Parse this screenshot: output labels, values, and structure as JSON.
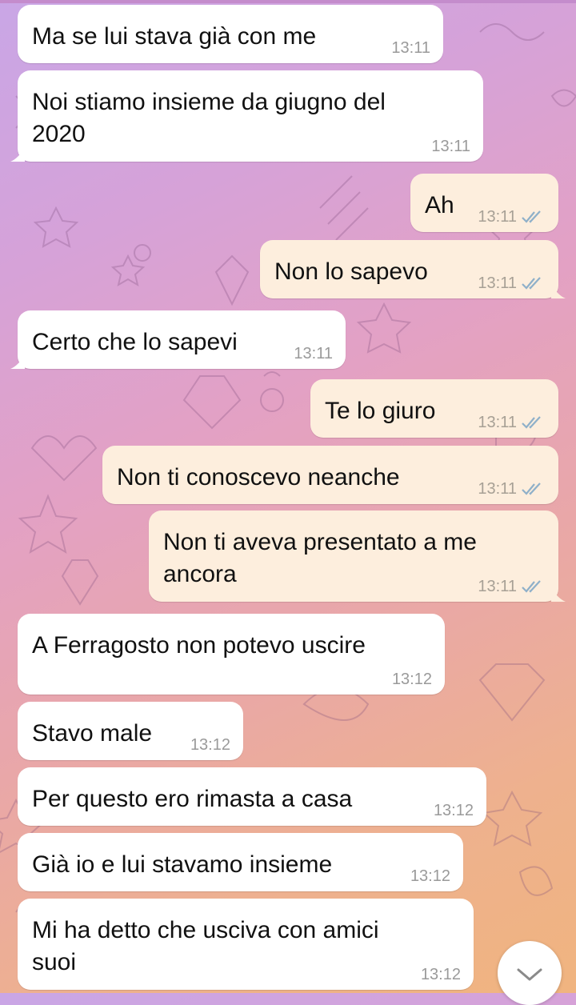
{
  "chat": {
    "messages": [
      {
        "text": "Ma se lui stava già con me",
        "time": "13:11",
        "direction": "incoming"
      },
      {
        "text": "Noi stiamo insieme da giugno del\n2020",
        "time": "13:11",
        "direction": "incoming"
      },
      {
        "text": "Ah",
        "time": "13:11",
        "direction": "outgoing",
        "status": "read"
      },
      {
        "text": "Non lo sapevo",
        "time": "13:11",
        "direction": "outgoing",
        "status": "read"
      },
      {
        "text": "Certo che lo sapevi",
        "time": "13:11",
        "direction": "incoming"
      },
      {
        "text": "Te lo giuro",
        "time": "13:11",
        "direction": "outgoing",
        "status": "read"
      },
      {
        "text": "Non ti conoscevo neanche",
        "time": "13:11",
        "direction": "outgoing",
        "status": "read"
      },
      {
        "text": "Non ti aveva presentato a me\nancora",
        "time": "13:11",
        "direction": "outgoing",
        "status": "read"
      },
      {
        "text": "A Ferragosto non potevo uscire",
        "time": "13:12",
        "direction": "incoming"
      },
      {
        "text": "Stavo male",
        "time": "13:12",
        "direction": "incoming"
      },
      {
        "text": "Per questo ero rimasta a casa",
        "time": "13:12",
        "direction": "incoming"
      },
      {
        "text": "Già io e lui stavamo insieme",
        "time": "13:12",
        "direction": "incoming"
      },
      {
        "text": "Mi ha detto che usciva con amici\nsuoi",
        "time": "13:12",
        "direction": "incoming"
      }
    ]
  },
  "colors": {
    "incoming_bubble": "#ffffff",
    "outgoing_bubble": "#fdeedd",
    "read_check": "#8fb0c9"
  },
  "icons": {
    "scroll_down": "chevron-down-icon",
    "read_receipt": "double-check-icon"
  }
}
